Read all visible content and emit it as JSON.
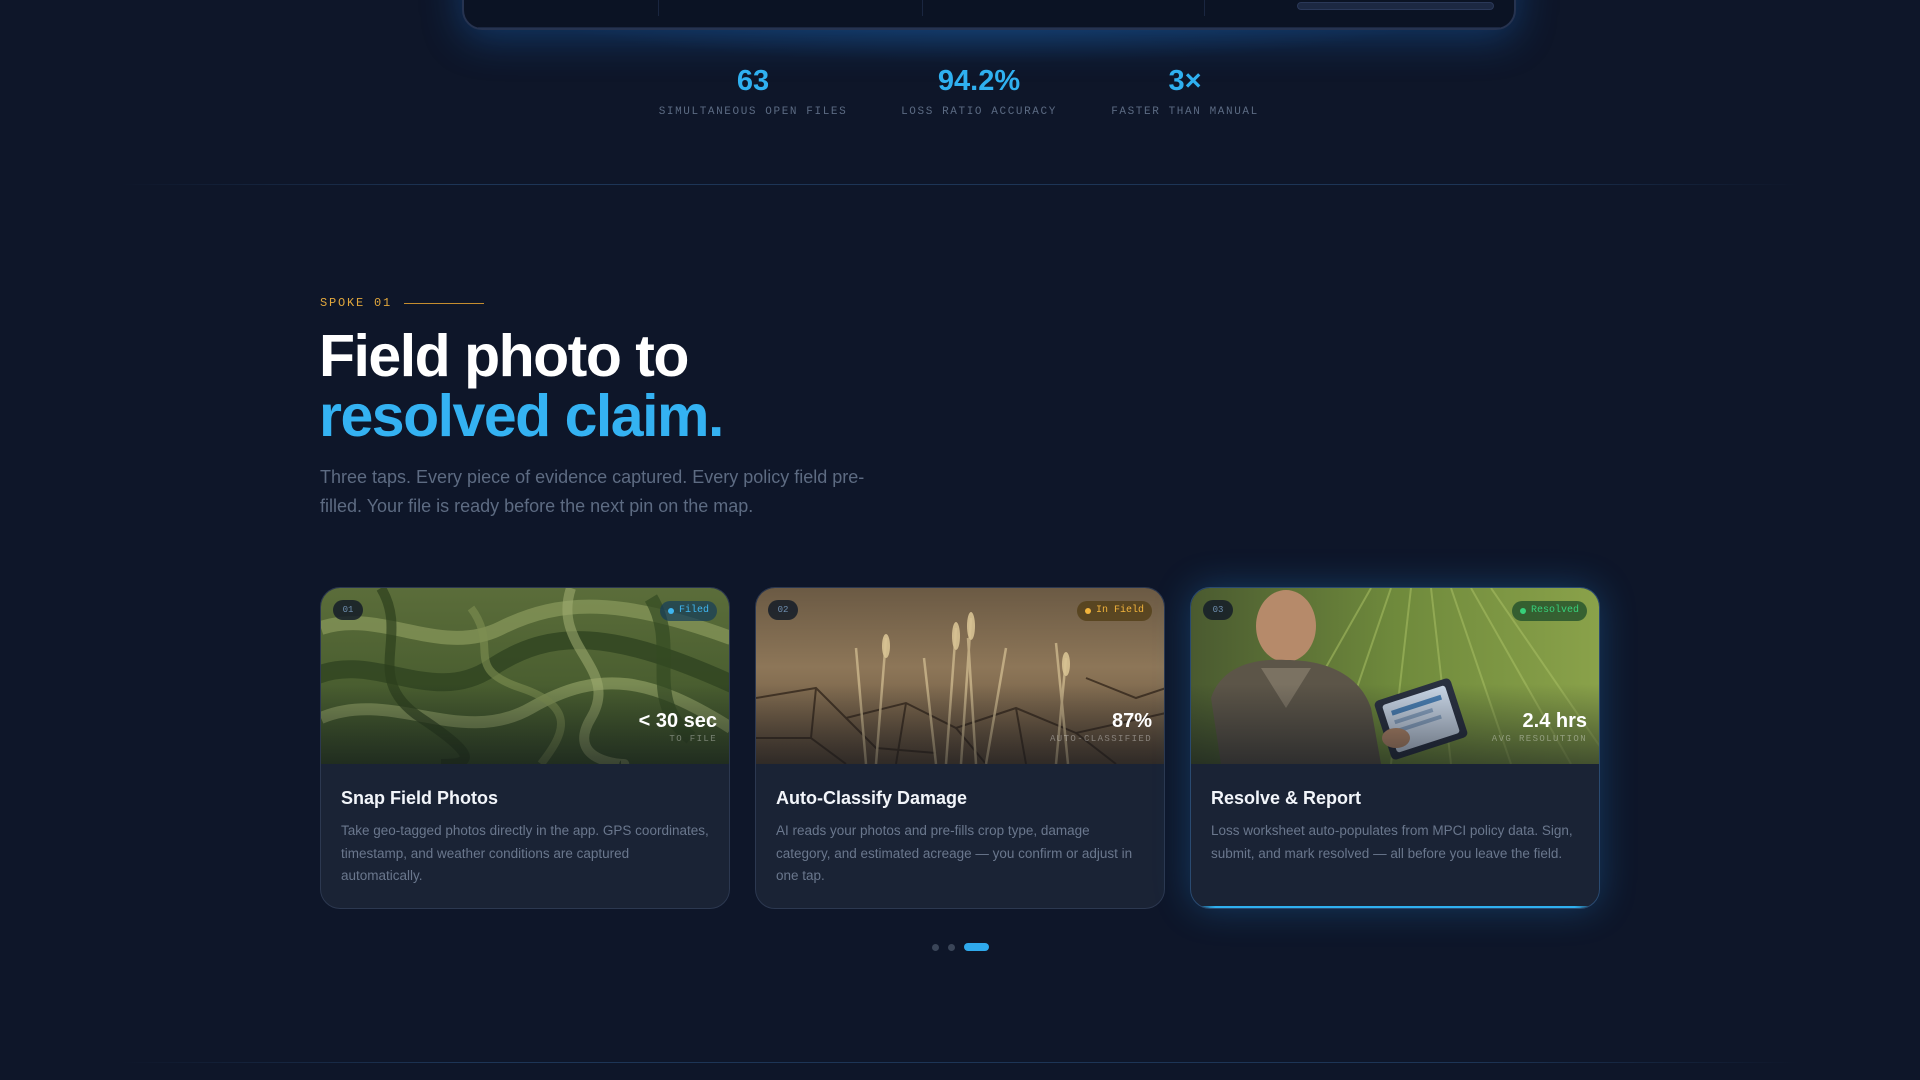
{
  "stats": [
    {
      "value": "63",
      "label": "SIMULTANEOUS OPEN FILES"
    },
    {
      "value": "94.2%",
      "label": "LOSS RATIO ACCURACY"
    },
    {
      "value": "3×",
      "label": "FASTER THAN MANUAL"
    }
  ],
  "section": {
    "eyebrow": "SPOKE 01",
    "headline_line1": "Field photo to",
    "headline_line2": "resolved claim.",
    "subtitle": "Three taps. Every piece of evidence captured. Every policy field pre-filled. Your file is ready before the next pin on the map."
  },
  "cards": [
    {
      "step": "01",
      "status": "Filed",
      "metric_value": "< 30 sec",
      "metric_label": "TO FILE",
      "title": "Snap Field Photos",
      "description": "Take geo-tagged photos directly in the app. GPS coordinates, timestamp, and weather conditions are captured automatically.",
      "image": "flattened-crop-field"
    },
    {
      "step": "02",
      "status": "In Field",
      "metric_value": "87%",
      "metric_label": "AUTO-CLASSIFIED",
      "title": "Auto-Classify Damage",
      "description": "AI reads your photos and pre-fills crop type, damage category, and estimated acreage — you confirm or adjust in one tap.",
      "image": "drought-cracked-soil"
    },
    {
      "step": "03",
      "status": "Resolved",
      "metric_value": "2.4 hrs",
      "metric_label": "AVG RESOLUTION",
      "title": "Resolve & Report",
      "description": "Loss worksheet auto-populates from MPCI policy data. Sign, submit, and mark resolved — all before you leave the field.",
      "image": "adjuster-with-tablet",
      "progress": 1.0
    }
  ],
  "carousel": {
    "total": 3,
    "active_index": 2
  },
  "colors": {
    "accent": "#2fb0f0",
    "eyebrow": "#e0a63c",
    "background": "#0e1629",
    "card": "#1a2335",
    "filed": "#3fb6f0",
    "in_field": "#f2b43c",
    "resolved": "#37d07a"
  }
}
